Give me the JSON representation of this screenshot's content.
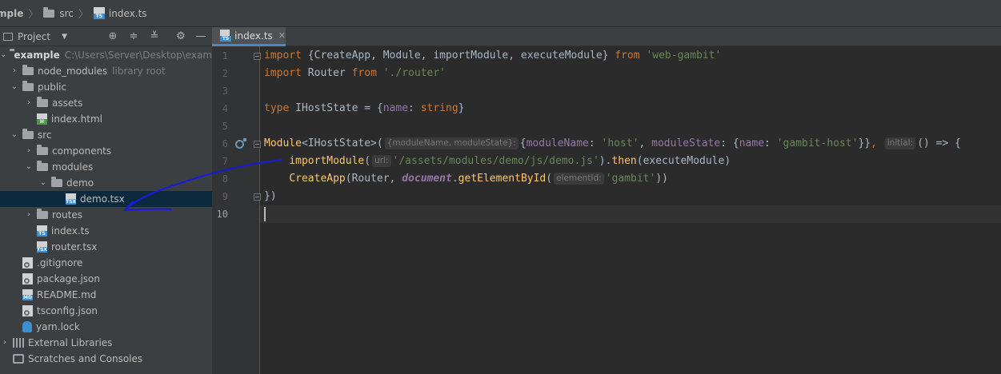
{
  "breadcrumb": {
    "items": [
      "mple",
      "src",
      "index.ts"
    ]
  },
  "project": {
    "title": "Project",
    "tree": [
      {
        "label": "example",
        "secondary": "C:\\Users\\Server\\Desktop\\example",
        "icon": "folder",
        "arrow": "down",
        "indent": 0
      },
      {
        "label": "node_modules",
        "secondary": "library root",
        "icon": "folder",
        "arrow": "right",
        "indent": 1
      },
      {
        "label": "public",
        "icon": "folder",
        "arrow": "down",
        "indent": 1
      },
      {
        "label": "assets",
        "icon": "folder",
        "arrow": "right",
        "indent": 2
      },
      {
        "label": "index.html",
        "icon": "html-file",
        "indent": 2
      },
      {
        "label": "src",
        "icon": "folder",
        "arrow": "down",
        "indent": 1
      },
      {
        "label": "components",
        "icon": "folder",
        "arrow": "right",
        "indent": 2
      },
      {
        "label": "modules",
        "icon": "folder",
        "arrow": "down",
        "indent": 2
      },
      {
        "label": "demo",
        "icon": "folder",
        "arrow": "down",
        "indent": 3
      },
      {
        "label": "demo.tsx",
        "icon": "tsx-file",
        "indent": 4,
        "selected": true
      },
      {
        "label": "routes",
        "icon": "folder",
        "arrow": "right",
        "indent": 2
      },
      {
        "label": "index.ts",
        "icon": "ts-file",
        "indent": 2
      },
      {
        "label": "router.tsx",
        "icon": "tsx-file",
        "indent": 2
      },
      {
        "label": ".gitignore",
        "icon": "config-file",
        "indent": 1
      },
      {
        "label": "package.json",
        "icon": "config-file",
        "indent": 1
      },
      {
        "label": "README.md",
        "icon": "md-file",
        "indent": 1
      },
      {
        "label": "tsconfig.json",
        "icon": "config-file",
        "indent": 1
      },
      {
        "label": "yarn.lock",
        "icon": "yarn-file",
        "indent": 1
      },
      {
        "label": "External Libraries",
        "icon": "libraries",
        "arrow": "right",
        "indent": 0
      },
      {
        "label": "Scratches and Consoles",
        "icon": "scratches",
        "indent": 0
      }
    ]
  },
  "editor": {
    "tab_label": "index.ts",
    "line_numbers": [
      "1",
      "2",
      "3",
      "4",
      "5",
      "6",
      "7",
      "8",
      "9",
      "10"
    ],
    "hints": {
      "line6a": "{moduleName, moduleState}:",
      "line6b": "initial:",
      "line7": "url:",
      "line8": "elementId:"
    },
    "code": {
      "l1": {
        "kw": "import",
        "p1": " {CreateApp, Module, importModule, executeModule} ",
        "from": "from",
        "str": "'web-gambit'"
      },
      "l2": {
        "kw": "import",
        "p1": " Router ",
        "from": "from",
        "str": "'./router'"
      },
      "l4": {
        "kw": "type",
        "p1": " IHostState = {",
        "prop": "name",
        "p2": ": ",
        "type": "string",
        "p3": "}"
      },
      "l6": {
        "fn": "Module",
        "p1": "<IHostState>(",
        "p2": "{",
        "prop1": "moduleName",
        "p3": ": ",
        "str1": "'host'",
        "p4": ", ",
        "prop2": "moduleState",
        "p5": ": {",
        "prop3": "name",
        "p6": ": ",
        "str2": "'gambit-host'",
        "p7": "}}",
        "p8": ", ",
        "p9": "() => {"
      },
      "l7": {
        "indent": "    ",
        "fn": "importModule",
        "p1": "(",
        "str": "'/assets/modules/demo/js/demo.js'",
        "p2": ").",
        "fn2": "then",
        "p3": "(executeModule)"
      },
      "l8": {
        "indent": "    ",
        "fn": "CreateApp",
        "p1": "(Router, ",
        "doc": "document",
        "p2": ".",
        "fn2": "getElementById",
        "p3": "(",
        "str": "'gambit'",
        "p4": "))"
      },
      "l9": {
        "p1": "})"
      }
    }
  },
  "colors": {
    "keyword": "#cc7832",
    "string": "#6a8759",
    "function": "#ffc66d",
    "property": "#9876aa",
    "annotation": "#1a1adf"
  }
}
